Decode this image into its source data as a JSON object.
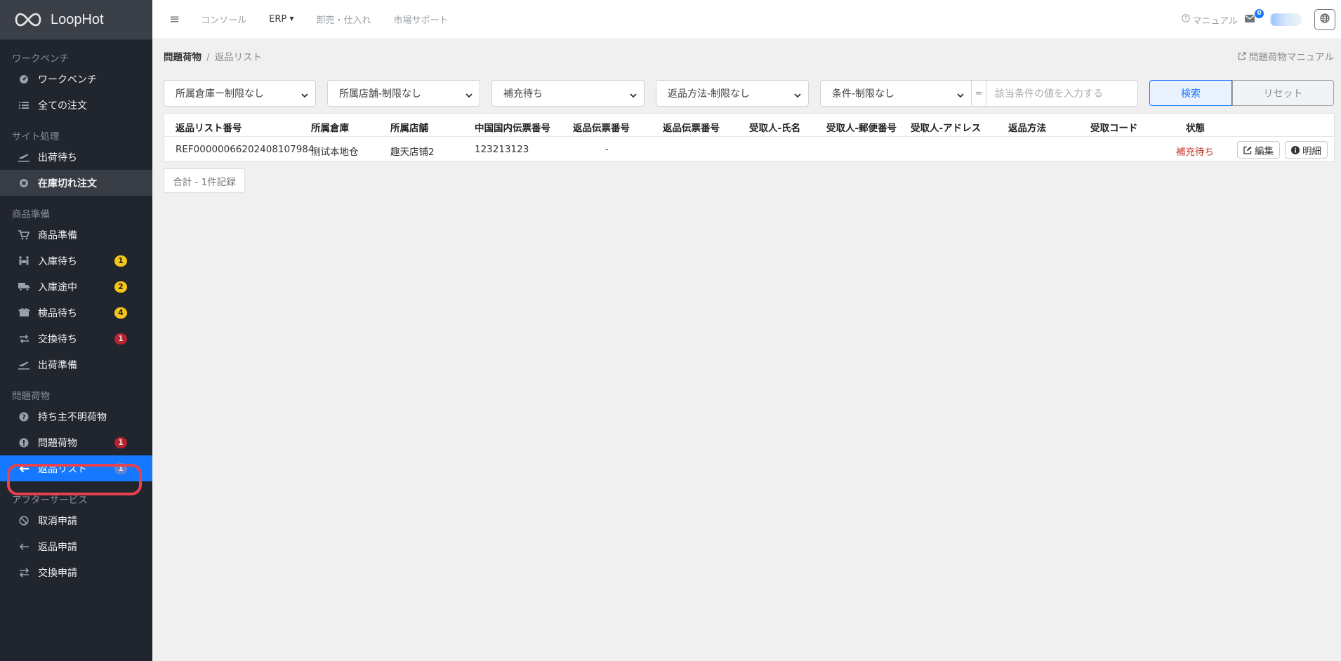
{
  "brand": {
    "name": "LoopHot"
  },
  "sidebar": {
    "sections": [
      {
        "title": "ワークベンチ",
        "items": [
          {
            "label": "ワークベンチ",
            "icon": "dashboard-icon"
          },
          {
            "label": "全ての注文",
            "icon": "list-icon"
          }
        ]
      },
      {
        "title": "サイト処理",
        "items": [
          {
            "label": "出荷待ち",
            "icon": "plane-departure-icon"
          },
          {
            "label": "在庫切れ注文",
            "icon": "stop-circle-icon"
          }
        ]
      },
      {
        "title": "商品準備",
        "items": [
          {
            "label": "商品準備",
            "icon": "cart-icon"
          },
          {
            "label": "入庫待ち",
            "icon": "people-carry-icon",
            "badge": "1"
          },
          {
            "label": "入庫途中",
            "icon": "truck-icon",
            "badge": "2"
          },
          {
            "label": "検品待ち",
            "icon": "box-open-icon",
            "badge": "4"
          },
          {
            "label": "交換待ち",
            "icon": "exchange-icon",
            "badge": "1"
          },
          {
            "label": "出荷準備",
            "icon": "plane-departure-icon"
          }
        ]
      },
      {
        "title": "問題荷物",
        "items": [
          {
            "label": "持ち主不明荷物",
            "icon": "question-circle-icon"
          },
          {
            "label": "問題荷物",
            "icon": "exclamation-circle-icon",
            "badge": "1"
          },
          {
            "label": "返品リスト",
            "icon": "arrow-left-icon",
            "badge": "1"
          }
        ]
      },
      {
        "title": "アフターサービス",
        "items": [
          {
            "label": "取消申請",
            "icon": "ban-icon"
          },
          {
            "label": "返品申請",
            "icon": "arrow-left-icon"
          },
          {
            "label": "交換申請",
            "icon": "exchange-icon"
          }
        ]
      }
    ],
    "colors": {
      "background": "#21252e",
      "active": "#1677ff",
      "highlight_ring": "#e8414e"
    }
  },
  "topbar": {
    "nav": [
      "コンソール",
      "ERP",
      "卸売・仕入れ",
      "市場サポート"
    ],
    "manual": "マニュアル",
    "mail_count": "0"
  },
  "breadcrumb": {
    "parent": "問題荷物",
    "current": "返品リスト"
  },
  "manual_link": "問題荷物マニュアル",
  "filters": {
    "warehouse": "所属倉庫ー制限なし",
    "store": "所属店舗-制限なし",
    "status": "補充待ち",
    "return_method": "返品方法-制限なし",
    "condition": "条件-制限なし",
    "eq": "=",
    "value_placeholder": "該当条件の値を入力する",
    "search": "検索",
    "reset": "リセット"
  },
  "table": {
    "headers": [
      "返品リスト番号",
      "所属倉庫",
      "所属店舗",
      "中国国内伝票番号",
      "返品伝票番号",
      "返品伝票番号",
      "受取人-氏名",
      "受取人-郵便番号",
      "受取人-アドレス",
      "返品方法",
      "受取コード",
      "状態"
    ],
    "rows": [
      {
        "id": "REF00000066202408107984",
        "warehouse": "测试本地仓",
        "store": "趣天店铺2",
        "cn_tracking": "123213123",
        "return_tracking": "-",
        "status": "補充待ち",
        "edit": "編集",
        "detail": "明細"
      }
    ],
    "status_color": "#c0392b"
  },
  "total": "合計 - 1件記録"
}
